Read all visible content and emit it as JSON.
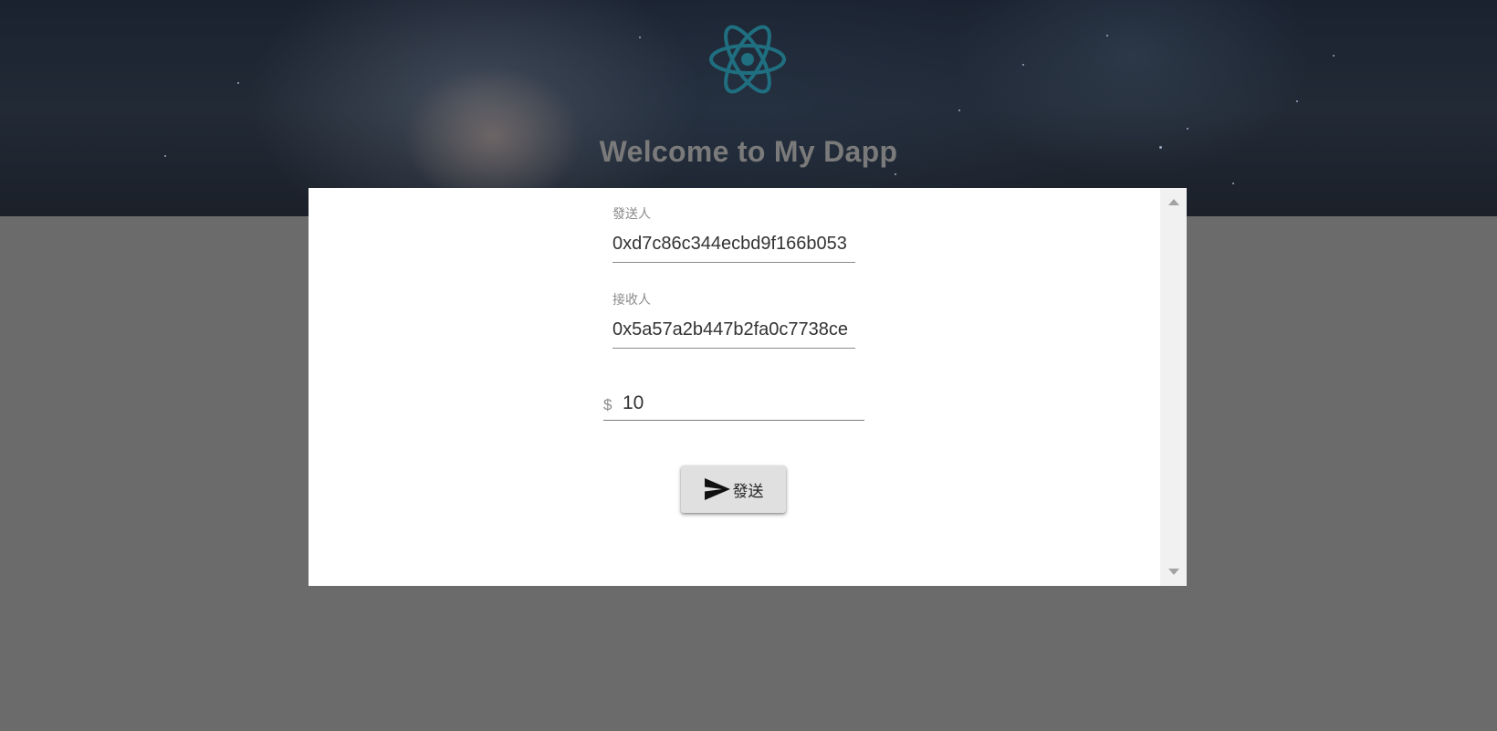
{
  "header": {
    "title": "Welcome to My Dapp",
    "logo_icon": "react-atom-icon",
    "logo_color": "#1f6f80"
  },
  "form": {
    "sender": {
      "label": "發送人",
      "value": "0xd7c86c344ecbd9f166b053"
    },
    "receiver": {
      "label": "接收人",
      "value": "0x5a57a2b447b2fa0c7738ce"
    },
    "amount": {
      "prefix": "$",
      "value": "10"
    },
    "send_button": {
      "label": "發送",
      "icon": "send-icon"
    }
  },
  "colors": {
    "overlay_background": "#6b6b6b",
    "panel_background": "#ffffff",
    "button_background": "#e0e0e0"
  }
}
